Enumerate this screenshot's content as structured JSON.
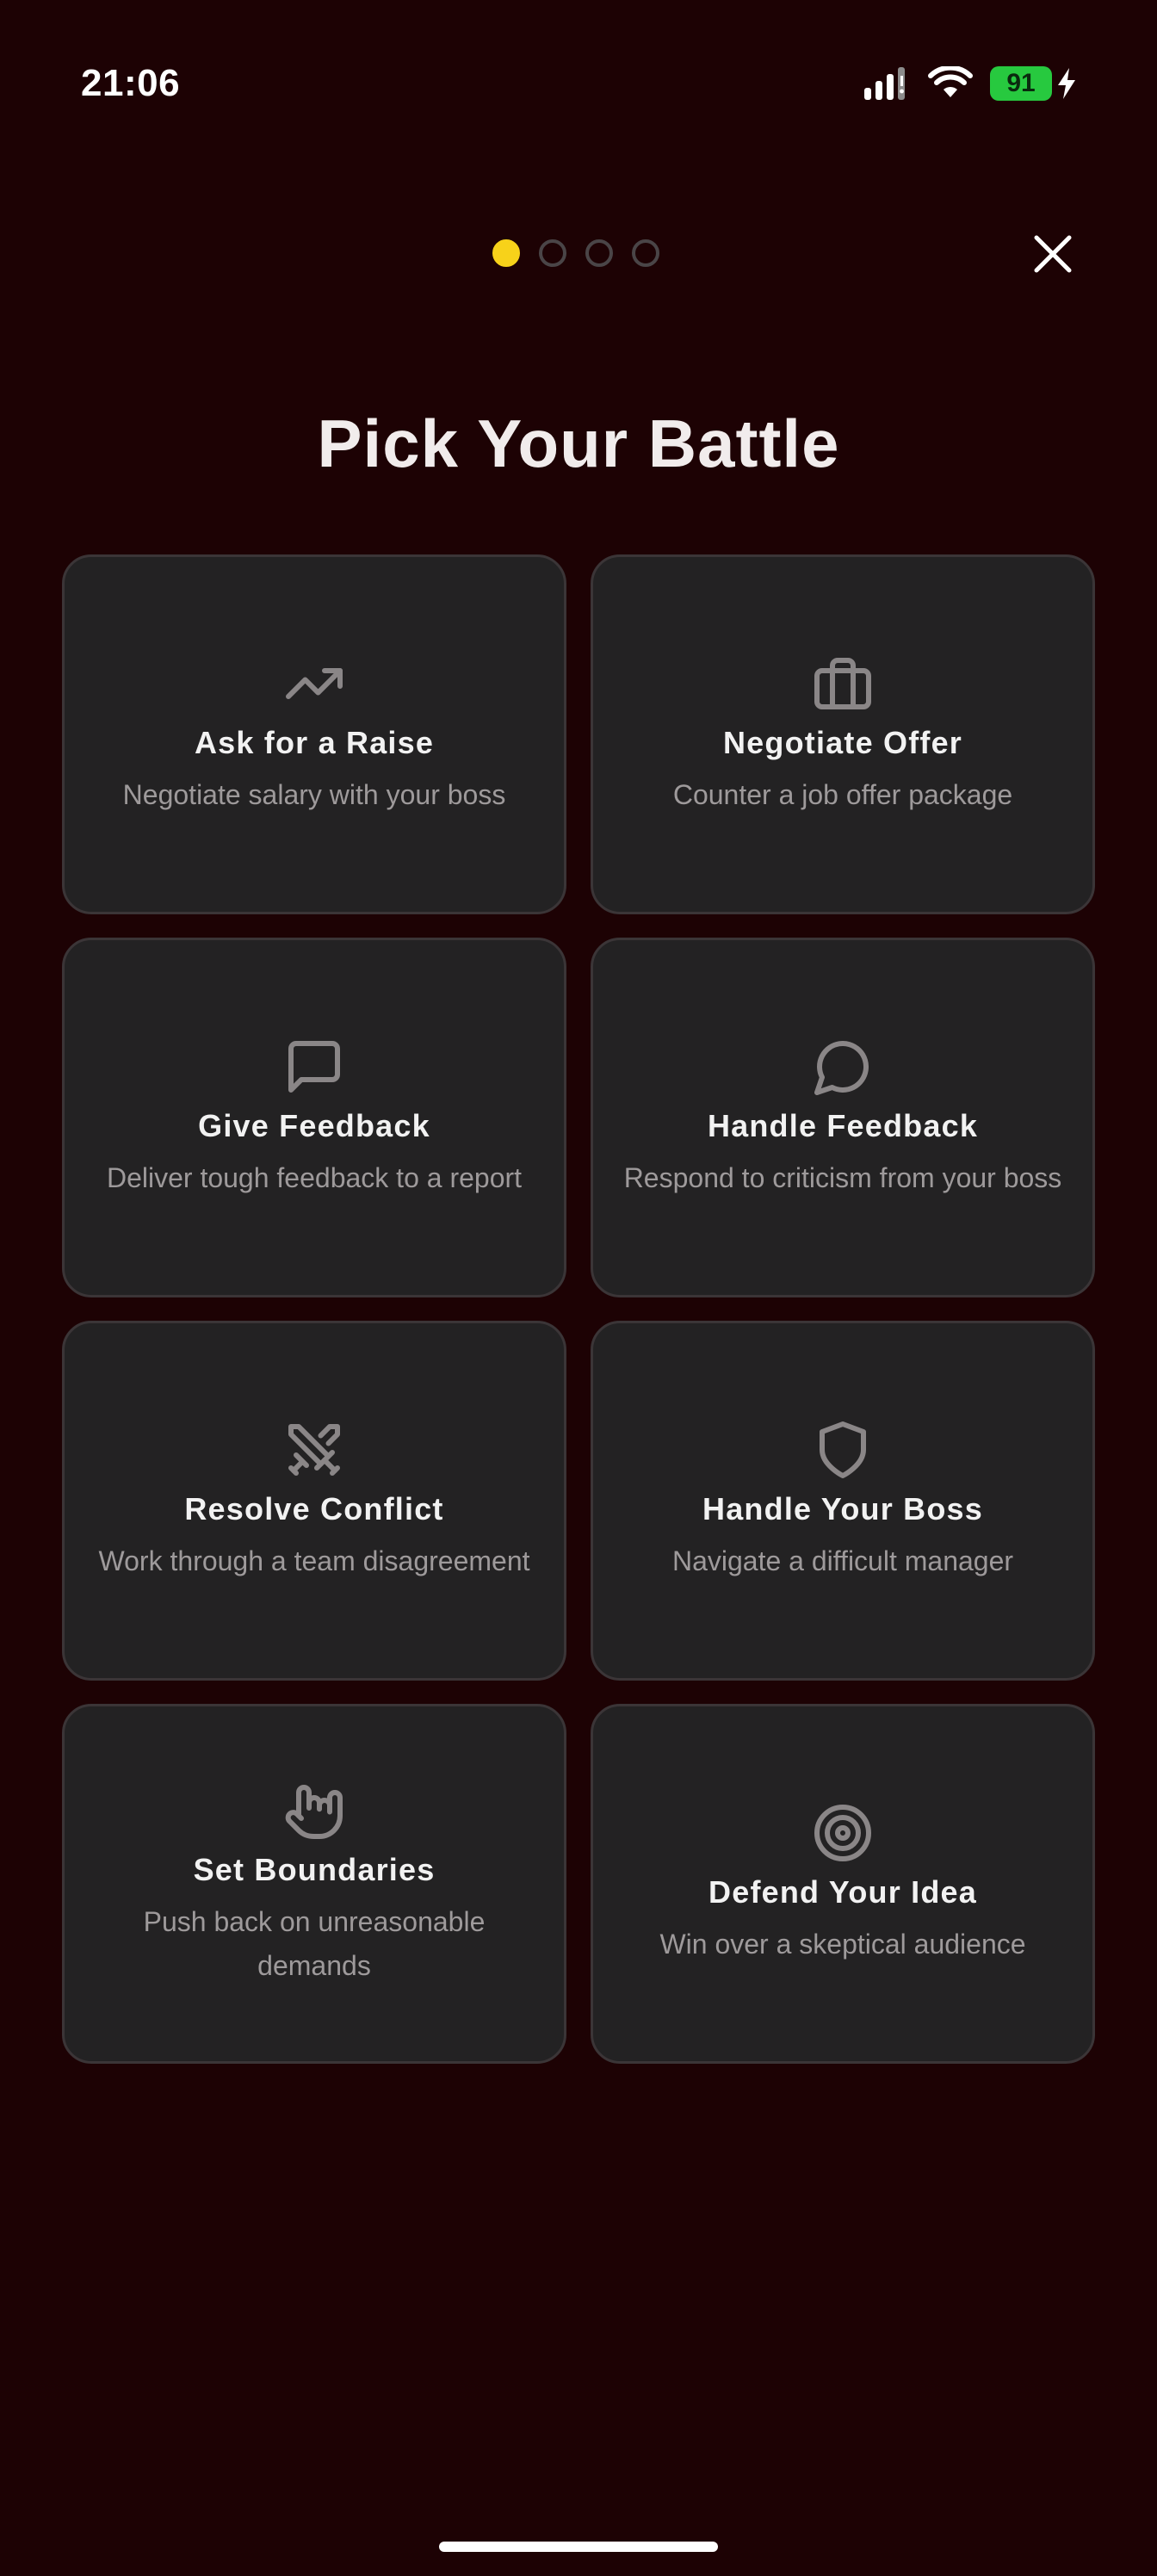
{
  "status_bar": {
    "time": "21:06",
    "battery": "91",
    "icons": [
      "signal-icon",
      "wifi-icon",
      "battery-icon",
      "charging-bolt-icon"
    ]
  },
  "pager": {
    "total": 4,
    "active_index": 0,
    "active_color": "#f7d21a"
  },
  "close_icon": "close-icon",
  "title": "Pick Your Battle",
  "cards": [
    {
      "icon": "trending-up-icon",
      "title": "Ask for a Raise",
      "description": "Negotiate salary with your boss"
    },
    {
      "icon": "briefcase-icon",
      "title": "Negotiate Offer",
      "description": "Counter a job offer package"
    },
    {
      "icon": "message-square-icon",
      "title": "Give Feedback",
      "description": "Deliver tough feedback to a report"
    },
    {
      "icon": "message-circle-icon",
      "title": "Handle Feedback",
      "description": "Respond to criticism from your boss"
    },
    {
      "icon": "crossed-swords-icon",
      "title": "Resolve Conflict",
      "description": "Work through a team disagreement"
    },
    {
      "icon": "shield-icon",
      "title": "Handle Your Boss",
      "description": "Navigate a difficult manager"
    },
    {
      "icon": "hand-icon",
      "title": "Set Boundaries",
      "description": "Push back on unreasonable demands"
    },
    {
      "icon": "target-icon",
      "title": "Defend Your Idea",
      "description": "Win over a skeptical audience"
    }
  ],
  "colors": {
    "background": "#1d0204",
    "card_background": "#232223",
    "card_border": "#3b3537",
    "icon": "#8a8687",
    "title_text": "#f2f2f2",
    "description_text": "#9e9a9b",
    "battery": "#27c93f"
  }
}
